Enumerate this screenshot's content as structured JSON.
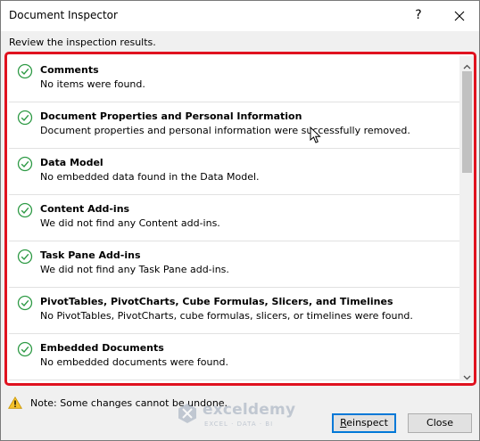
{
  "window": {
    "title": "Document Inspector",
    "help_label": "?",
    "close_label": "✕"
  },
  "subtitle": "Review the inspection results.",
  "results": [
    {
      "title": "Comments",
      "description": "No items were found."
    },
    {
      "title": "Document Properties and Personal Information",
      "description": "Document properties and personal information were successfully removed."
    },
    {
      "title": "Data Model",
      "description": "No embedded data found in the Data Model."
    },
    {
      "title": "Content Add-ins",
      "description": "We did not find any Content add-ins."
    },
    {
      "title": "Task Pane Add-ins",
      "description": "We did not find any Task Pane add-ins."
    },
    {
      "title": "PivotTables, PivotCharts, Cube Formulas, Slicers, and Timelines",
      "description": "No PivotTables, PivotCharts, cube formulas, slicers, or timelines were found."
    },
    {
      "title": "Embedded Documents",
      "description": "No embedded documents were found."
    }
  ],
  "note": "Note: Some changes cannot be undone.",
  "watermark": {
    "name": "exceldemy",
    "tagline": "EXCEL · DATA · BI"
  },
  "buttons": {
    "reinspect": {
      "accel": "R",
      "rest": "einspect"
    },
    "close": "Close"
  },
  "colors": {
    "highlight_border": "#e0121f",
    "check_green": "#2e9a45",
    "warning_yellow": "#f5c22b",
    "default_button_border": "#0078d7"
  },
  "icons": {
    "result_status": "check-circle-icon",
    "note": "warning-icon"
  }
}
